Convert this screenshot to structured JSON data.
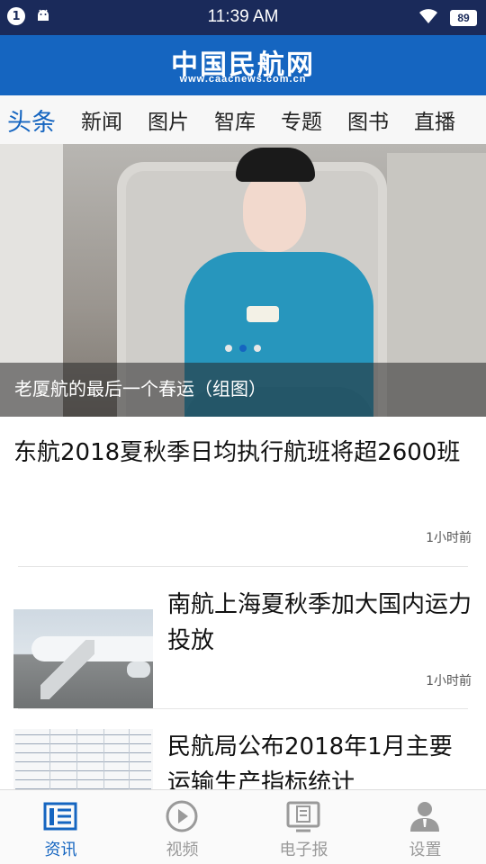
{
  "status_bar": {
    "notification_count": "1",
    "time": "11:39 AM",
    "battery": "89"
  },
  "header": {
    "brand_name": "中国民航网",
    "brand_url": "www.caacnews.com.cn"
  },
  "tabs": [
    {
      "label": "头条",
      "active": true
    },
    {
      "label": "新闻",
      "active": false
    },
    {
      "label": "图片",
      "active": false
    },
    {
      "label": "智库",
      "active": false
    },
    {
      "label": "专题",
      "active": false
    },
    {
      "label": "图书",
      "active": false
    },
    {
      "label": "直播",
      "active": false
    }
  ],
  "hero": {
    "caption": "老厦航的最后一个春运（组图）",
    "slide_count": 3,
    "active_slide": 2
  },
  "articles": [
    {
      "title": "东航2018夏秋季日均执行航班将超2600班",
      "time": "1小时前"
    },
    {
      "title": "南航上海夏秋季加大国内运力投放",
      "time": "1小时前"
    },
    {
      "title": "民航局公布2018年1月主要运输生产指标统计",
      "time": ""
    }
  ],
  "bottom_nav": [
    {
      "label": "资讯",
      "icon": "news-list-icon",
      "active": true
    },
    {
      "label": "视频",
      "icon": "play-icon",
      "active": false
    },
    {
      "label": "电子报",
      "icon": "epaper-icon",
      "active": false
    },
    {
      "label": "设置",
      "icon": "user-settings-icon",
      "active": false
    }
  ],
  "colors": {
    "accent": "#1565c0",
    "status_bar": "#1a2a5a",
    "inactive": "#9a9a9a"
  }
}
